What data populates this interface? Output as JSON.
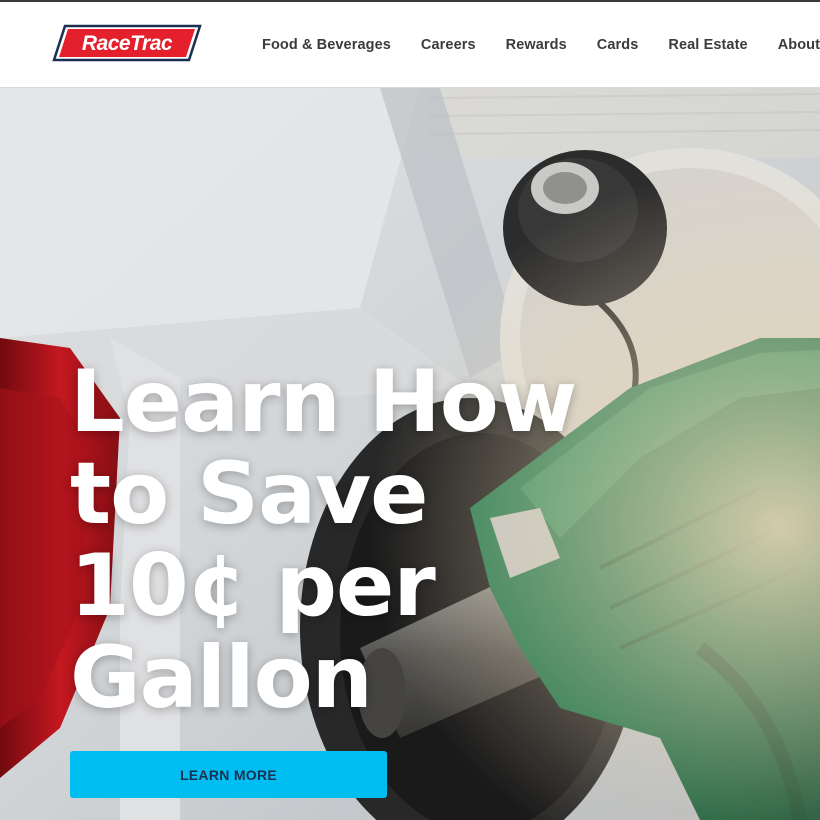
{
  "header": {
    "logo_text": "RaceTrac",
    "nav": [
      {
        "label": "Food & Beverages"
      },
      {
        "label": "Careers"
      },
      {
        "label": "Rewards"
      },
      {
        "label": "Cards"
      },
      {
        "label": "Real Estate"
      },
      {
        "label": "About Us"
      }
    ]
  },
  "hero": {
    "headline_lines": [
      "Learn How",
      "to Save",
      "10¢ per",
      "Gallon"
    ],
    "cta_label": "LEARN MORE"
  },
  "colors": {
    "brand_red": "#e3202c",
    "brand_navy": "#1b2f52",
    "cta_blue": "#00bef2",
    "nav_text": "#3b3b3b"
  },
  "icons": {
    "logo": "racetrac-logo"
  }
}
